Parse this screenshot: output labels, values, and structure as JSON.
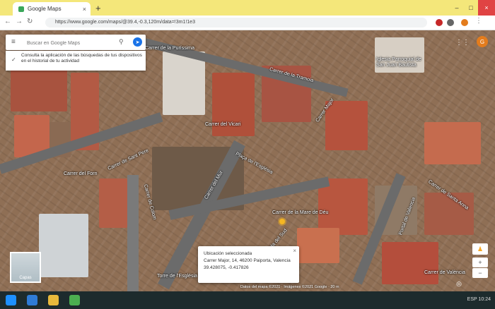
{
  "browser": {
    "tab_title": "Google Maps",
    "tab_close": "×",
    "new_tab": "+",
    "url": "https://www.google.com/maps/@39.4,-0.3,120m/data=!3m1!1e3",
    "win_min": "–",
    "win_max": "□",
    "win_close": "×"
  },
  "search": {
    "menu_icon": "≡",
    "placeholder": "Buscar en Google Maps",
    "search_icon": "⚲",
    "directions_icon": "➤",
    "suggestion": "Consulta la aplicación de las búsquedas de tus dispositivos en el historial de tu actividad",
    "suggestion_icon": "✓"
  },
  "account": {
    "initial": "G",
    "apps_icon": "⋮⋮"
  },
  "map_labels": [
    "Carrer de la Puríssima",
    "Iglesia Parroquial de San Juan Bautista",
    "Carrer de la Tramoia",
    "Carrer del Vicari",
    "Carrer de Sant Pere",
    "Plaça de l'Església",
    "Carrer Major",
    "Carrer del Forn",
    "Carrer de Colom",
    "Carrer del Mur",
    "Carrer de Santa Anna",
    "Carrer de València",
    "Portal de Valencia",
    "Avinguda del Sud",
    "Carrer de la Mare de Déu",
    "Torre de l'Església"
  ],
  "info_card": {
    "title": "Ubicación seleccionada",
    "line1": "Carrer Major, 14, 46200 Paiporta, Valencia",
    "line2": "39.428075, -0.417826",
    "close": "×"
  },
  "minimap": {
    "label": "Capas"
  },
  "controls": {
    "zoom_in": "+",
    "zoom_out": "−",
    "compass": "◎",
    "pegman": "♟"
  },
  "scale": "Datos del mapa ©2021 · Imágenes ©2021 Google · 20 m",
  "taskbar": {
    "clock": "ESP 10:24"
  },
  "colors": {
    "tab_strip": "#f4e77a",
    "pin": "#f5b622",
    "avatar": "#e37c1d",
    "accent": "#1a73e8"
  }
}
